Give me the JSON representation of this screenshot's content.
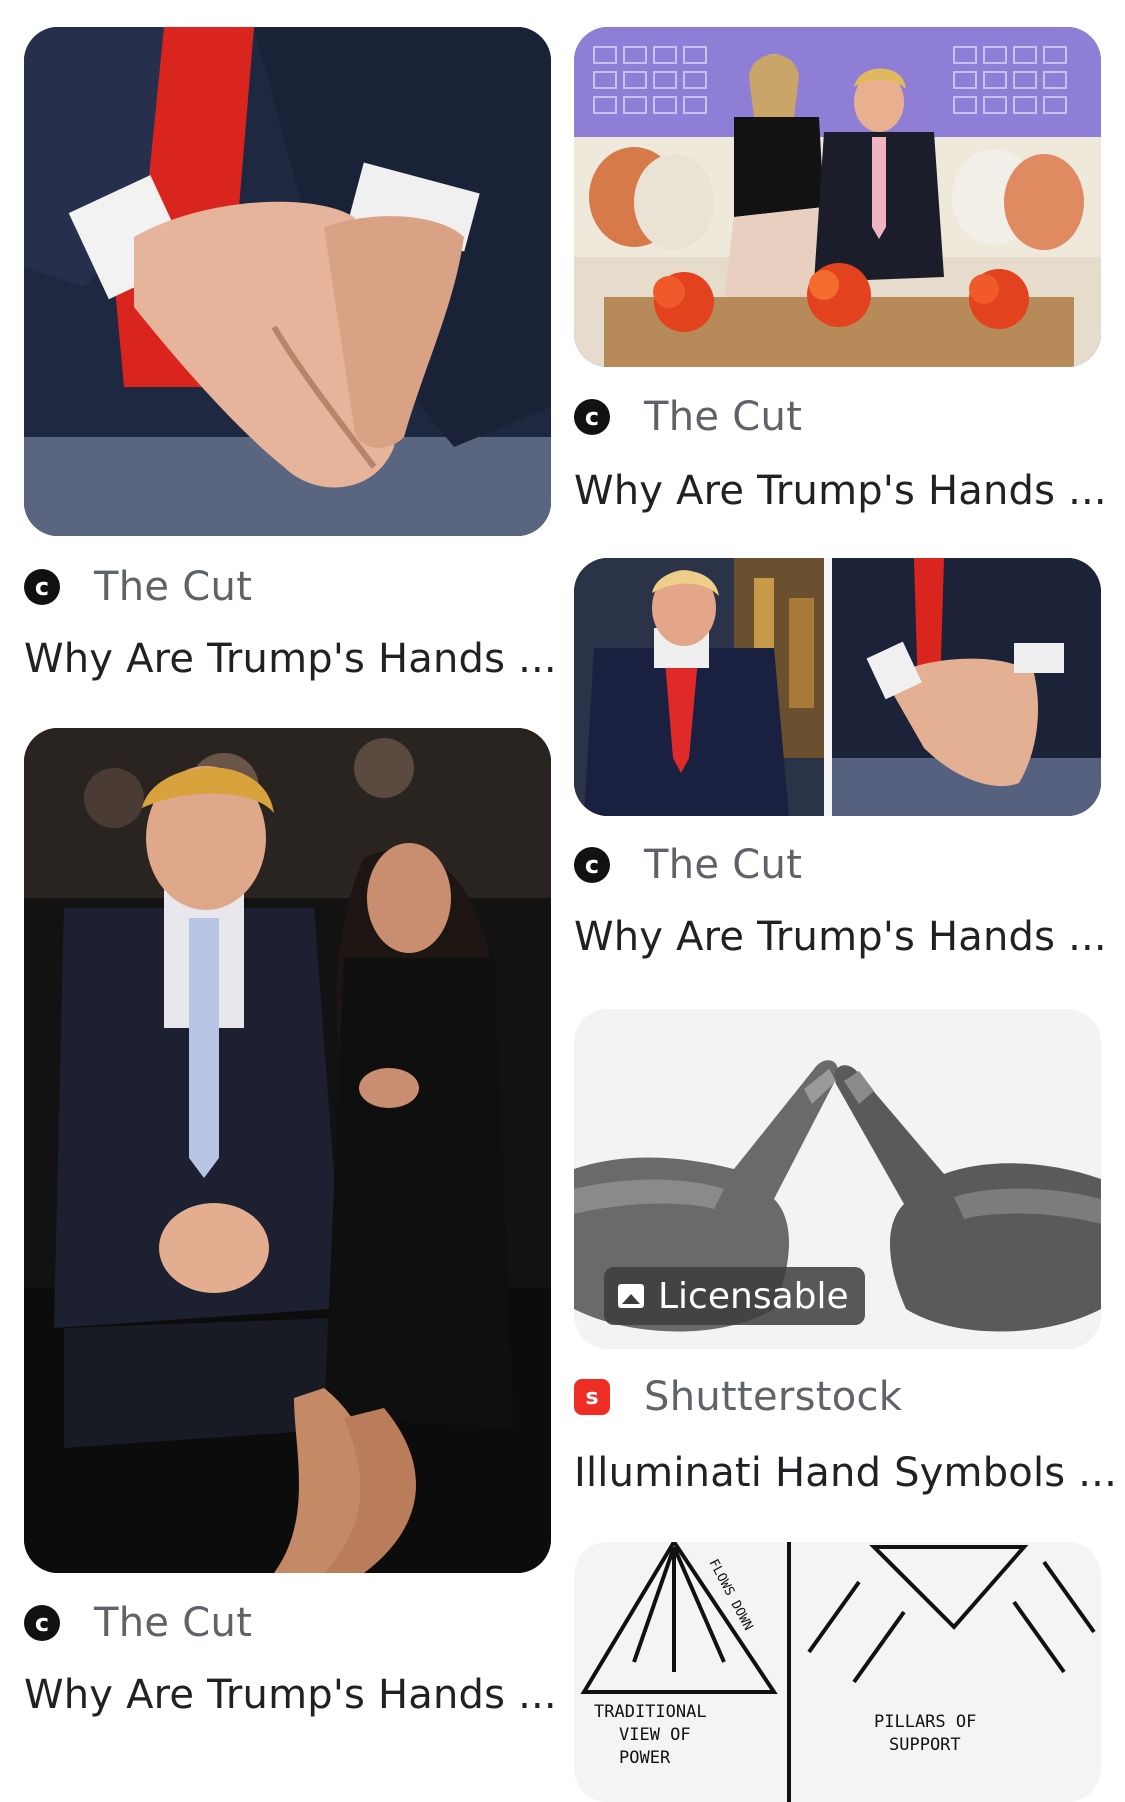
{
  "results": [
    {
      "id": "r1",
      "source": "The Cut",
      "source_icon": "the-cut-logo-icon",
      "title": "Why Are Trump's Hands ...",
      "image": "trump-hands-closeup-image"
    },
    {
      "id": "r2",
      "source": "The Cut",
      "source_icon": "the-cut-logo-icon",
      "title": "Why Are Trump's Hands ...",
      "image": "trump-couple-event-image"
    },
    {
      "id": "r3",
      "source": "The Cut",
      "source_icon": "the-cut-logo-icon",
      "title": "Why Are Trump's Hands ...",
      "image": "trump-ivanka-sofa-image"
    },
    {
      "id": "r4",
      "source": "The Cut",
      "source_icon": "the-cut-logo-icon",
      "title": "Why Are Trump's Hands ...",
      "image": "trump-talkshow-split-image"
    },
    {
      "id": "r5",
      "source": "Shutterstock",
      "source_icon": "shutterstock-logo-icon",
      "title": "Illuminati Hand Symbols ...",
      "badge": "Licensable",
      "image": "hand-triangle-bw-image"
    },
    {
      "id": "r6",
      "image": "power-diagram-sketch-image",
      "sketch_text": {
        "flows": "FLOWS DOWN",
        "traditional_1": "TRADITIONAL",
        "traditional_2": "VIEW OF",
        "traditional_3": "POWER",
        "pillars_1": "PILLARS OF",
        "pillars_2": "SUPPORT"
      }
    }
  ],
  "colors": {
    "source_text": "#5f6368",
    "title_text": "#202124",
    "shutterstock_red": "#ee2e24"
  }
}
